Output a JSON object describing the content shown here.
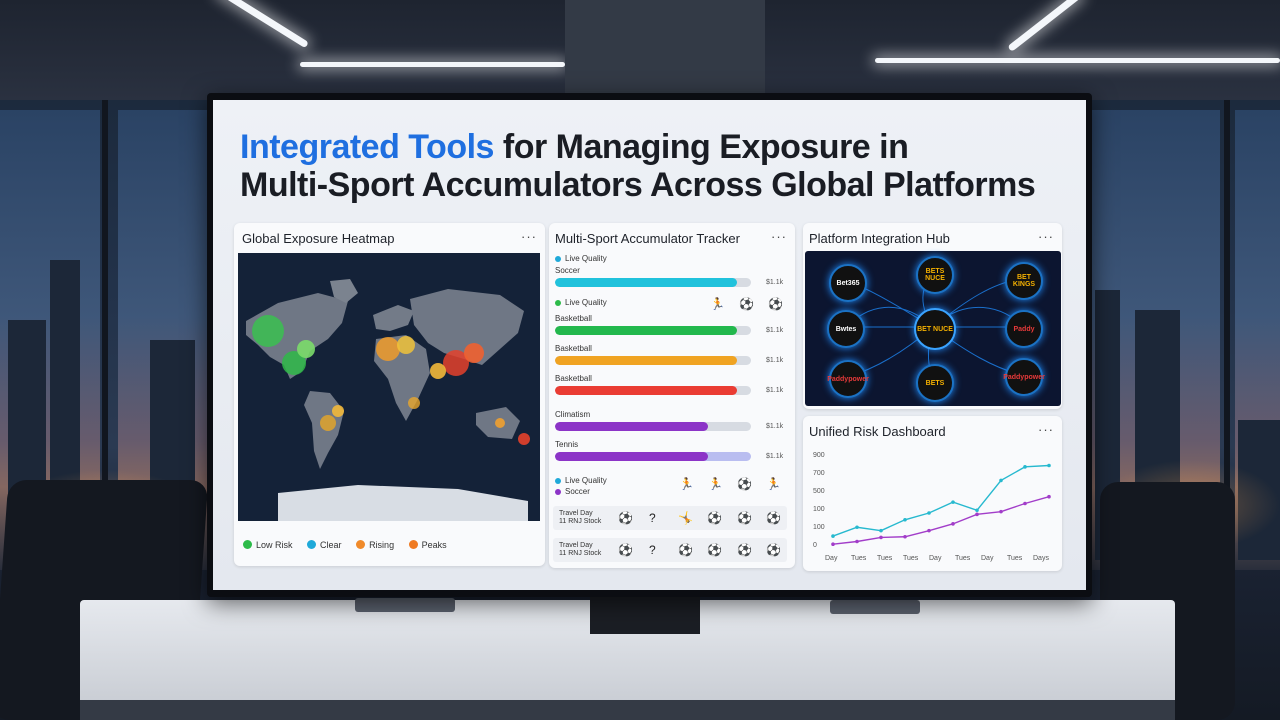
{
  "headline": {
    "highlight": "Integrated Tools",
    "rest_line1": " for Managing Exposure in",
    "line2": "Multi-Sport Accumulators Across Global Platforms"
  },
  "heatmap": {
    "title": "Global Exposure Heatmap",
    "menu": "···",
    "legend": [
      {
        "label": "Low Risk",
        "color": "#2dbb4a"
      },
      {
        "label": "Clear",
        "color": "#1fa9d9"
      },
      {
        "label": "Rising",
        "color": "#f08a2a"
      },
      {
        "label": "Peaks",
        "color": "#ef7a22"
      }
    ]
  },
  "tracker": {
    "title": "Multi-Sport Accumulator Tracker",
    "menu": "···",
    "rows": [
      {
        "label": "Soccer",
        "value": "$1.1k",
        "fill": 0.93,
        "color": "#21c2dc"
      },
      {
        "label": "Basketball",
        "value": "$1.1k",
        "fill": 0.93,
        "color": "#23b84d"
      },
      {
        "label": "Basketball",
        "value": "$1.1k",
        "fill": 0.93,
        "color": "#f0a322"
      },
      {
        "label": "Basketball",
        "value": "$1.1k",
        "fill": 0.93,
        "color": "#ea3c33"
      },
      {
        "label": "Climatism",
        "value": "$1.1k",
        "fill": 0.78,
        "color": "#8c34c7"
      },
      {
        "label": "Tennis",
        "value": "$1.1k",
        "fill": 0.78,
        "color": "#8c34c7"
      }
    ],
    "status_a": "Live Quality",
    "status_b": "Live Quality",
    "status_c": "Live Quality",
    "status_c_label": "Soccer",
    "sub_rows": [
      {
        "line1": "Travel Day",
        "line2": "11 RNJ Stock"
      },
      {
        "line1": "Travel Day",
        "line2": "11 RNJ Stock"
      }
    ]
  },
  "hub": {
    "title": "Platform Integration Hub",
    "menu": "···",
    "nodes": [
      "Bet365",
      "BETS NUCE",
      "BET KINGS",
      "Bwtes",
      "BET NUCE",
      "Paddy",
      "Paddypower",
      "BETS",
      "Paddypower"
    ]
  },
  "risk": {
    "title": "Unified Risk Dashboard",
    "menu": "···"
  },
  "chart_data": {
    "type": "line",
    "title": "Unified Risk Dashboard",
    "x": [
      "Day",
      "Tues",
      "Tues",
      "Tues",
      "Day",
      "Tues",
      "Day",
      "Tues",
      "Days"
    ],
    "ylabel": "",
    "yticks": [
      "900",
      "700",
      "500",
      "100",
      "100",
      "0"
    ],
    "series": [
      {
        "color": "#27b9cf",
        "values": [
          110,
          175,
          150,
          230,
          280,
          360,
          300,
          520,
          620,
          630
        ]
      },
      {
        "color": "#a23dc9",
        "values": [
          50,
          70,
          100,
          105,
          150,
          200,
          270,
          290,
          350,
          400
        ]
      }
    ]
  }
}
